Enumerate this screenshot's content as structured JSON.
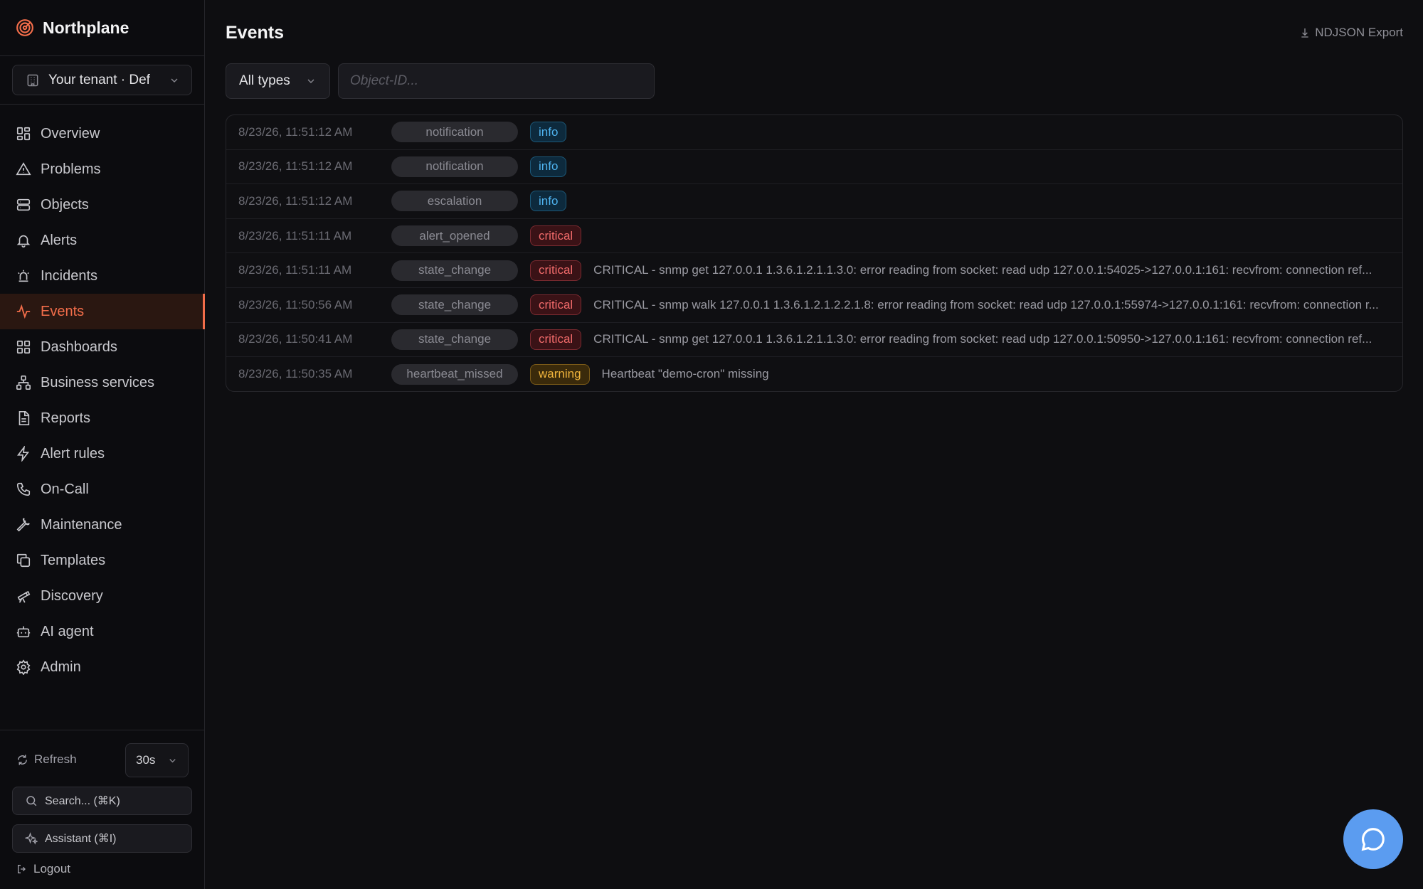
{
  "app": {
    "name": "Northplane"
  },
  "tenant": {
    "label": "Your tenant · Def"
  },
  "nav": {
    "items": [
      {
        "label": "Overview",
        "icon": "grid-icon"
      },
      {
        "label": "Problems",
        "icon": "warning-triangle-icon"
      },
      {
        "label": "Objects",
        "icon": "server-icon"
      },
      {
        "label": "Alerts",
        "icon": "bell-icon"
      },
      {
        "label": "Incidents",
        "icon": "siren-icon"
      },
      {
        "label": "Events",
        "icon": "activity-icon",
        "active": true
      },
      {
        "label": "Dashboards",
        "icon": "grid-icon"
      },
      {
        "label": "Business services",
        "icon": "network-icon"
      },
      {
        "label": "Reports",
        "icon": "document-icon"
      },
      {
        "label": "Alert rules",
        "icon": "lightning-icon"
      },
      {
        "label": "On-Call",
        "icon": "phone-icon"
      },
      {
        "label": "Maintenance",
        "icon": "wrench-icon"
      },
      {
        "label": "Templates",
        "icon": "copy-icon"
      },
      {
        "label": "Discovery",
        "icon": "telescope-icon"
      },
      {
        "label": "AI agent",
        "icon": "bot-icon"
      },
      {
        "label": "Admin",
        "icon": "gear-icon"
      }
    ]
  },
  "footer": {
    "refresh_label": "Refresh",
    "interval": "30s",
    "search_label": "Search... (⌘K)",
    "assistant_label": "Assistant (⌘I)",
    "logout_label": "Logout"
  },
  "page": {
    "title": "Events",
    "export_label": "NDJSON Export"
  },
  "filters": {
    "type_value": "All types",
    "object_placeholder": "Object-ID..."
  },
  "colors": {
    "accent": "#f26d4a",
    "info": "#4fb3ef",
    "critical": "#f26b6b",
    "warning": "#f0b43c",
    "chat_fab": "#5b9cf0"
  },
  "events": [
    {
      "timestamp": "8/23/26, 11:51:12 AM",
      "type": "notification",
      "severity": "info",
      "message": ""
    },
    {
      "timestamp": "8/23/26, 11:51:12 AM",
      "type": "notification",
      "severity": "info",
      "message": ""
    },
    {
      "timestamp": "8/23/26, 11:51:12 AM",
      "type": "escalation",
      "severity": "info",
      "message": ""
    },
    {
      "timestamp": "8/23/26, 11:51:11 AM",
      "type": "alert_opened",
      "severity": "critical",
      "message": ""
    },
    {
      "timestamp": "8/23/26, 11:51:11 AM",
      "type": "state_change",
      "severity": "critical",
      "message": "CRITICAL - snmp get 127.0.0.1 1.3.6.1.2.1.1.3.0: error reading from socket: read udp 127.0.0.1:54025->127.0.0.1:161: recvfrom: connection ref..."
    },
    {
      "timestamp": "8/23/26, 11:50:56 AM",
      "type": "state_change",
      "severity": "critical",
      "message": "CRITICAL - snmp walk 127.0.0.1 1.3.6.1.2.1.2.2.1.8: error reading from socket: read udp 127.0.0.1:55974->127.0.0.1:161: recvfrom: connection r..."
    },
    {
      "timestamp": "8/23/26, 11:50:41 AM",
      "type": "state_change",
      "severity": "critical",
      "message": "CRITICAL - snmp get 127.0.0.1 1.3.6.1.2.1.1.3.0: error reading from socket: read udp 127.0.0.1:50950->127.0.0.1:161: recvfrom: connection ref..."
    },
    {
      "timestamp": "8/23/26, 11:50:35 AM",
      "type": "heartbeat_missed",
      "severity": "warning",
      "message": "Heartbeat \"demo-cron\" missing"
    }
  ]
}
